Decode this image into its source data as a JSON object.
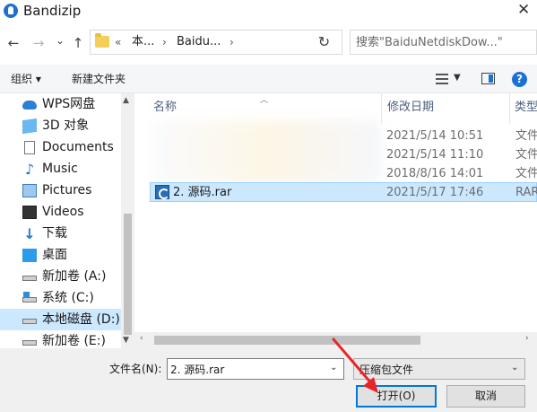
{
  "window": {
    "title": "Bandizip",
    "close_glyph": "✕"
  },
  "nav": {
    "back_glyph": "←",
    "forward_glyph": "→",
    "history_glyph": "⌄",
    "up_glyph": "↑",
    "address_segments": [
      "«",
      "本...",
      "›",
      "Baidu...",
      "›"
    ],
    "address_dropdown_glyph": "⌄",
    "refresh_glyph": "↻",
    "search_placeholder": "搜索\"BaiduNetdiskDow...\""
  },
  "toolbar": {
    "organize_label": "组织 ▾",
    "new_folder_label": "新建文件夹",
    "view_dropdown_glyph": "▼",
    "help_glyph": "?"
  },
  "sidebar": {
    "items": [
      {
        "label": "WPS网盘",
        "icon": "cloud-icon",
        "selected": false
      },
      {
        "label": "3D 对象",
        "icon": "3d-objects-icon",
        "selected": false
      },
      {
        "label": "Documents",
        "icon": "document-icon",
        "selected": false
      },
      {
        "label": "Music",
        "icon": "music-icon",
        "selected": false
      },
      {
        "label": "Pictures",
        "icon": "pictures-icon",
        "selected": false
      },
      {
        "label": "Videos",
        "icon": "video-icon",
        "selected": false
      },
      {
        "label": "下载",
        "icon": "download-icon",
        "selected": false
      },
      {
        "label": "桌面",
        "icon": "desktop-icon",
        "selected": false
      },
      {
        "label": "新加卷 (A:)",
        "icon": "drive-icon",
        "selected": false
      },
      {
        "label": "系统 (C:)",
        "icon": "system-drive-icon",
        "selected": false
      },
      {
        "label": "本地磁盘 (D:)",
        "icon": "drive-icon",
        "selected": true
      },
      {
        "label": "新加卷 (E:)",
        "icon": "drive-icon",
        "selected": false
      }
    ],
    "scroll_up_glyph": "▲",
    "scroll_down_glyph": "▼"
  },
  "filelist": {
    "columns": {
      "name": "名称",
      "modified": "修改日期",
      "type": "类型"
    },
    "rows": [
      {
        "name": "",
        "modified": "2021/5/14 10:51",
        "type": "文件",
        "selected": false
      },
      {
        "name": "",
        "modified": "2021/5/14 11:10",
        "type": "文件",
        "selected": false
      },
      {
        "name": "",
        "modified": "2018/8/16 14:01",
        "type": "文件",
        "selected": false
      },
      {
        "name": "2. 源码.rar",
        "modified": "2021/5/17 17:46",
        "type": "RAR",
        "selected": true
      }
    ],
    "hscroll_left_glyph": "‹",
    "hscroll_right_glyph": "›"
  },
  "footer": {
    "filename_label": "文件名(N):",
    "filename_value": "2. 源码.rar",
    "filetype_value": "压缩包文件",
    "dropdown_glyph": "⌄",
    "open_label": "打开(O)",
    "cancel_label": "取消"
  },
  "colors": {
    "accent": "#0078d7",
    "selection": "#cce8ff",
    "annotation_arrow": "#e8262a"
  }
}
